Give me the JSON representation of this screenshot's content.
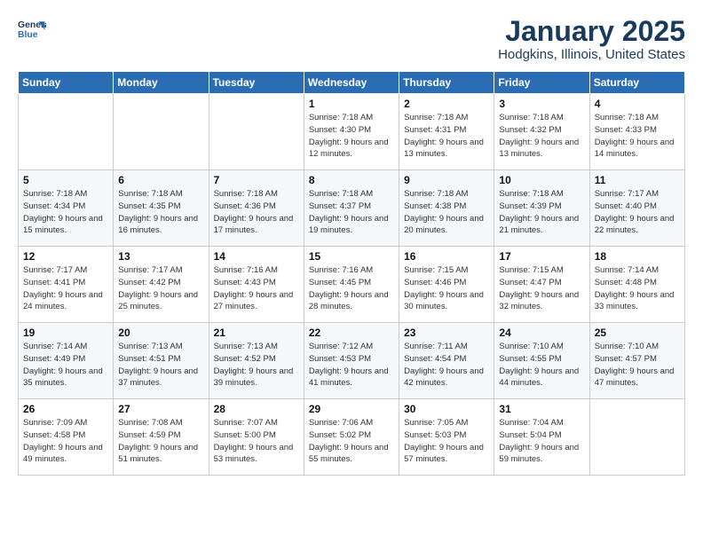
{
  "header": {
    "logo_line1": "General",
    "logo_line2": "Blue",
    "title": "January 2025",
    "subtitle": "Hodgkins, Illinois, United States"
  },
  "days_of_week": [
    "Sunday",
    "Monday",
    "Tuesday",
    "Wednesday",
    "Thursday",
    "Friday",
    "Saturday"
  ],
  "weeks": [
    [
      {
        "num": "",
        "detail": ""
      },
      {
        "num": "",
        "detail": ""
      },
      {
        "num": "",
        "detail": ""
      },
      {
        "num": "1",
        "detail": "Sunrise: 7:18 AM\nSunset: 4:30 PM\nDaylight: 9 hours\nand 12 minutes."
      },
      {
        "num": "2",
        "detail": "Sunrise: 7:18 AM\nSunset: 4:31 PM\nDaylight: 9 hours\nand 13 minutes."
      },
      {
        "num": "3",
        "detail": "Sunrise: 7:18 AM\nSunset: 4:32 PM\nDaylight: 9 hours\nand 13 minutes."
      },
      {
        "num": "4",
        "detail": "Sunrise: 7:18 AM\nSunset: 4:33 PM\nDaylight: 9 hours\nand 14 minutes."
      }
    ],
    [
      {
        "num": "5",
        "detail": "Sunrise: 7:18 AM\nSunset: 4:34 PM\nDaylight: 9 hours\nand 15 minutes."
      },
      {
        "num": "6",
        "detail": "Sunrise: 7:18 AM\nSunset: 4:35 PM\nDaylight: 9 hours\nand 16 minutes."
      },
      {
        "num": "7",
        "detail": "Sunrise: 7:18 AM\nSunset: 4:36 PM\nDaylight: 9 hours\nand 17 minutes."
      },
      {
        "num": "8",
        "detail": "Sunrise: 7:18 AM\nSunset: 4:37 PM\nDaylight: 9 hours\nand 19 minutes."
      },
      {
        "num": "9",
        "detail": "Sunrise: 7:18 AM\nSunset: 4:38 PM\nDaylight: 9 hours\nand 20 minutes."
      },
      {
        "num": "10",
        "detail": "Sunrise: 7:18 AM\nSunset: 4:39 PM\nDaylight: 9 hours\nand 21 minutes."
      },
      {
        "num": "11",
        "detail": "Sunrise: 7:17 AM\nSunset: 4:40 PM\nDaylight: 9 hours\nand 22 minutes."
      }
    ],
    [
      {
        "num": "12",
        "detail": "Sunrise: 7:17 AM\nSunset: 4:41 PM\nDaylight: 9 hours\nand 24 minutes."
      },
      {
        "num": "13",
        "detail": "Sunrise: 7:17 AM\nSunset: 4:42 PM\nDaylight: 9 hours\nand 25 minutes."
      },
      {
        "num": "14",
        "detail": "Sunrise: 7:16 AM\nSunset: 4:43 PM\nDaylight: 9 hours\nand 27 minutes."
      },
      {
        "num": "15",
        "detail": "Sunrise: 7:16 AM\nSunset: 4:45 PM\nDaylight: 9 hours\nand 28 minutes."
      },
      {
        "num": "16",
        "detail": "Sunrise: 7:15 AM\nSunset: 4:46 PM\nDaylight: 9 hours\nand 30 minutes."
      },
      {
        "num": "17",
        "detail": "Sunrise: 7:15 AM\nSunset: 4:47 PM\nDaylight: 9 hours\nand 32 minutes."
      },
      {
        "num": "18",
        "detail": "Sunrise: 7:14 AM\nSunset: 4:48 PM\nDaylight: 9 hours\nand 33 minutes."
      }
    ],
    [
      {
        "num": "19",
        "detail": "Sunrise: 7:14 AM\nSunset: 4:49 PM\nDaylight: 9 hours\nand 35 minutes."
      },
      {
        "num": "20",
        "detail": "Sunrise: 7:13 AM\nSunset: 4:51 PM\nDaylight: 9 hours\nand 37 minutes."
      },
      {
        "num": "21",
        "detail": "Sunrise: 7:13 AM\nSunset: 4:52 PM\nDaylight: 9 hours\nand 39 minutes."
      },
      {
        "num": "22",
        "detail": "Sunrise: 7:12 AM\nSunset: 4:53 PM\nDaylight: 9 hours\nand 41 minutes."
      },
      {
        "num": "23",
        "detail": "Sunrise: 7:11 AM\nSunset: 4:54 PM\nDaylight: 9 hours\nand 42 minutes."
      },
      {
        "num": "24",
        "detail": "Sunrise: 7:10 AM\nSunset: 4:55 PM\nDaylight: 9 hours\nand 44 minutes."
      },
      {
        "num": "25",
        "detail": "Sunrise: 7:10 AM\nSunset: 4:57 PM\nDaylight: 9 hours\nand 47 minutes."
      }
    ],
    [
      {
        "num": "26",
        "detail": "Sunrise: 7:09 AM\nSunset: 4:58 PM\nDaylight: 9 hours\nand 49 minutes."
      },
      {
        "num": "27",
        "detail": "Sunrise: 7:08 AM\nSunset: 4:59 PM\nDaylight: 9 hours\nand 51 minutes."
      },
      {
        "num": "28",
        "detail": "Sunrise: 7:07 AM\nSunset: 5:00 PM\nDaylight: 9 hours\nand 53 minutes."
      },
      {
        "num": "29",
        "detail": "Sunrise: 7:06 AM\nSunset: 5:02 PM\nDaylight: 9 hours\nand 55 minutes."
      },
      {
        "num": "30",
        "detail": "Sunrise: 7:05 AM\nSunset: 5:03 PM\nDaylight: 9 hours\nand 57 minutes."
      },
      {
        "num": "31",
        "detail": "Sunrise: 7:04 AM\nSunset: 5:04 PM\nDaylight: 9 hours\nand 59 minutes."
      },
      {
        "num": "",
        "detail": ""
      }
    ]
  ]
}
